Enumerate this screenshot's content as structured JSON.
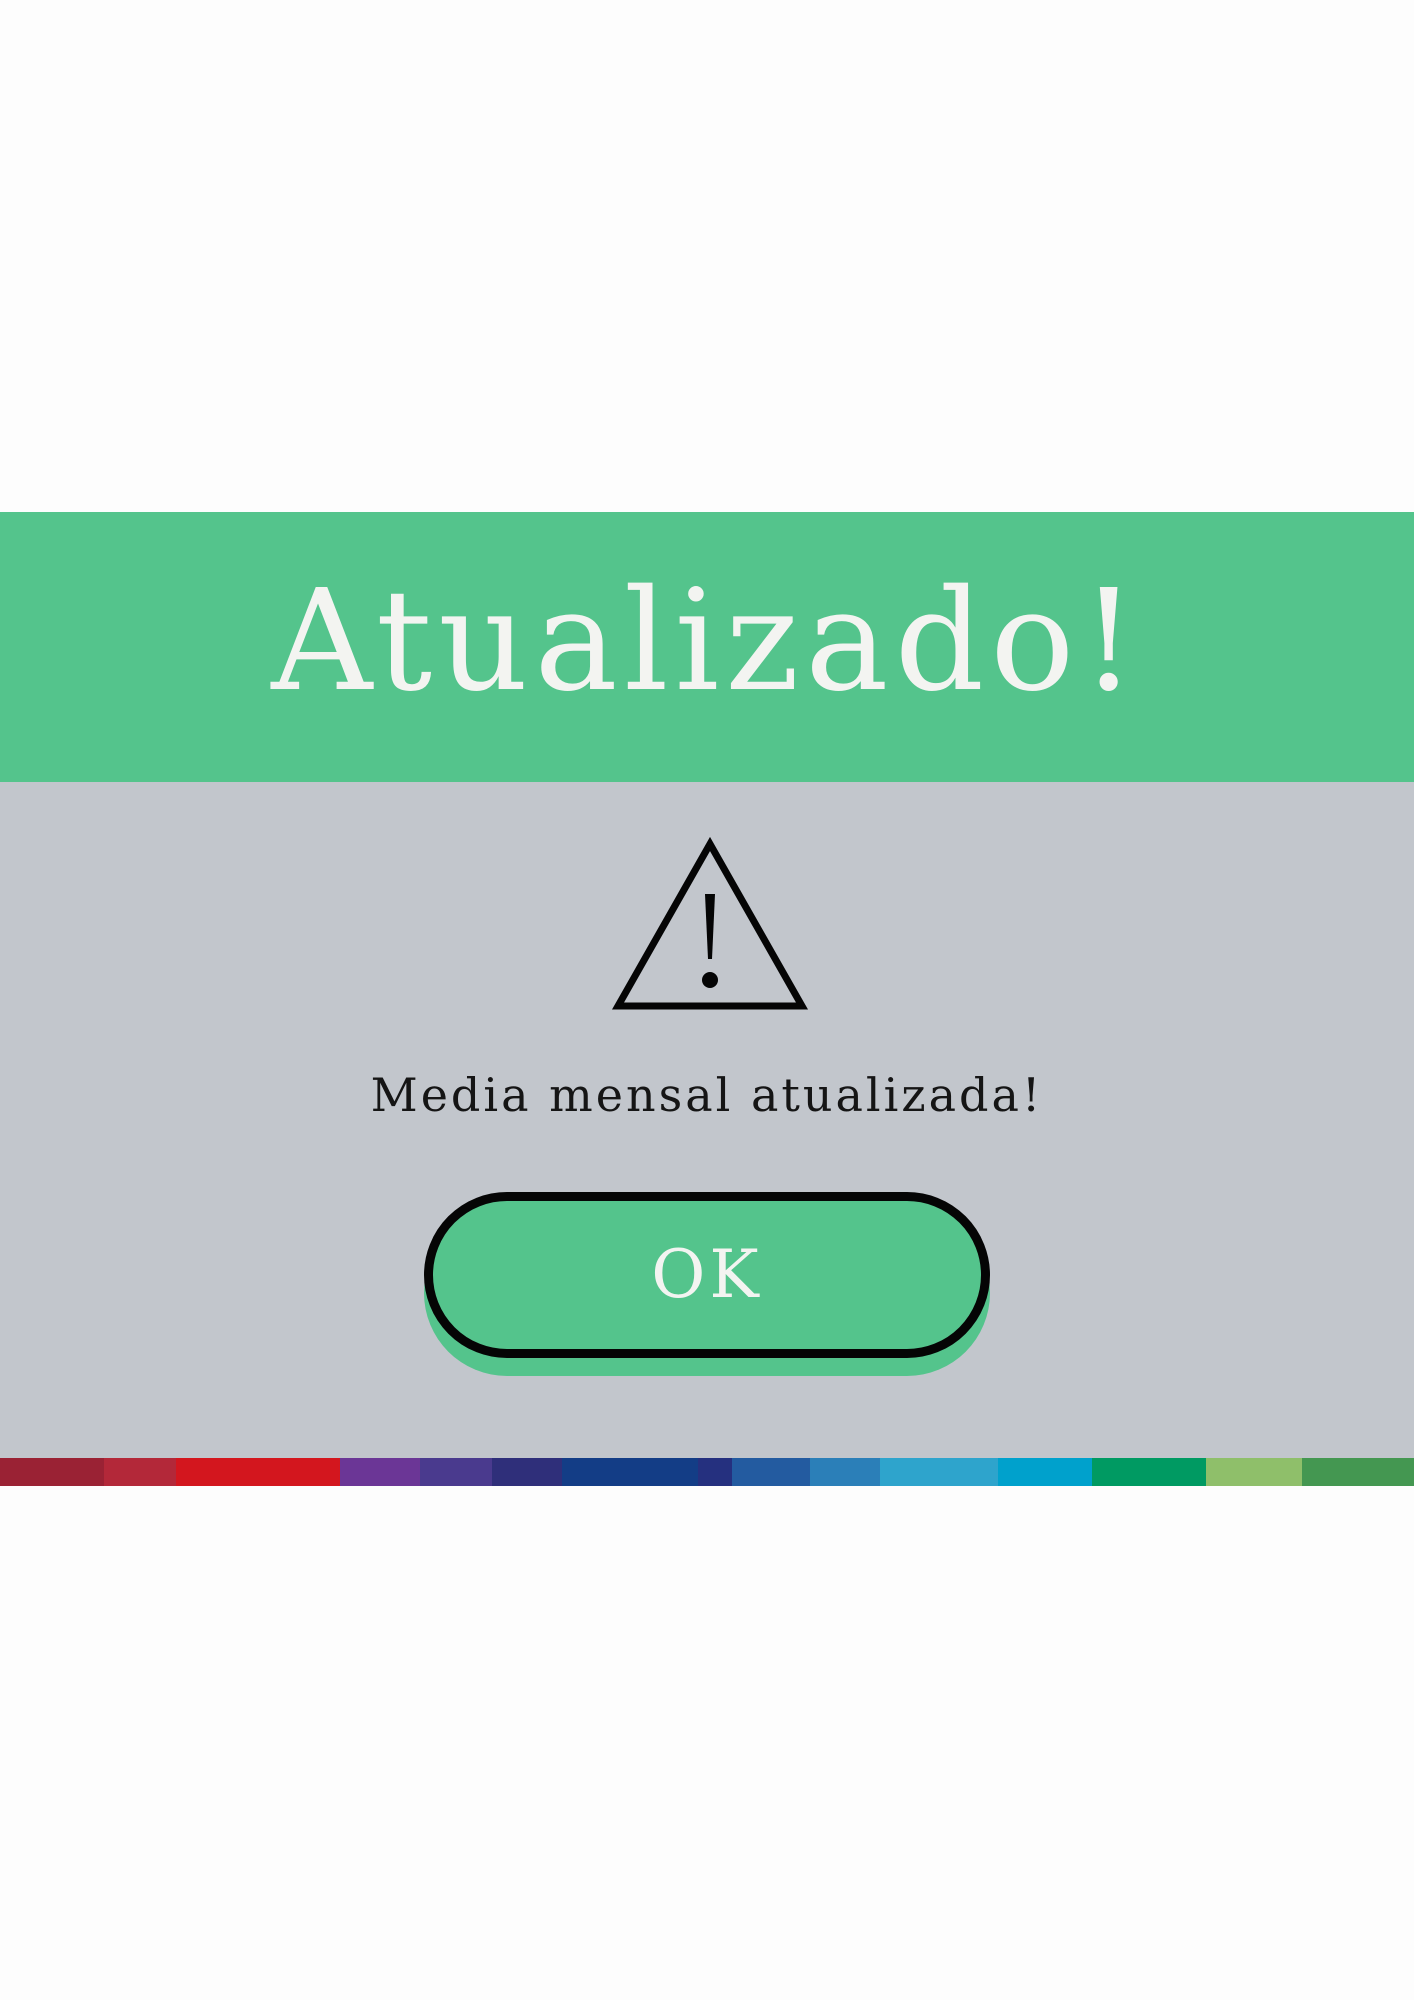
{
  "dialog": {
    "title": "Atualizado!",
    "icon": "warning-triangle-icon",
    "message": "Media mensal atualizada!",
    "ok_label": "OK"
  },
  "colors": {
    "header": "#54c48c",
    "body": "#c2c6cc",
    "button": "#54c48c",
    "button_border": "#050505",
    "title_text": "#f3f4f1",
    "message_text": "#151515",
    "strip": [
      "#9a2234",
      "#b32839",
      "#d3161e",
      "#6b3696",
      "#4a3a8e",
      "#2f2f7a",
      "#133d86",
      "#25307f",
      "#235ba0",
      "#2b7fb8",
      "#2ea4cc",
      "#00a1cc",
      "#009a62",
      "#8fbf6a",
      "#449751"
    ]
  }
}
